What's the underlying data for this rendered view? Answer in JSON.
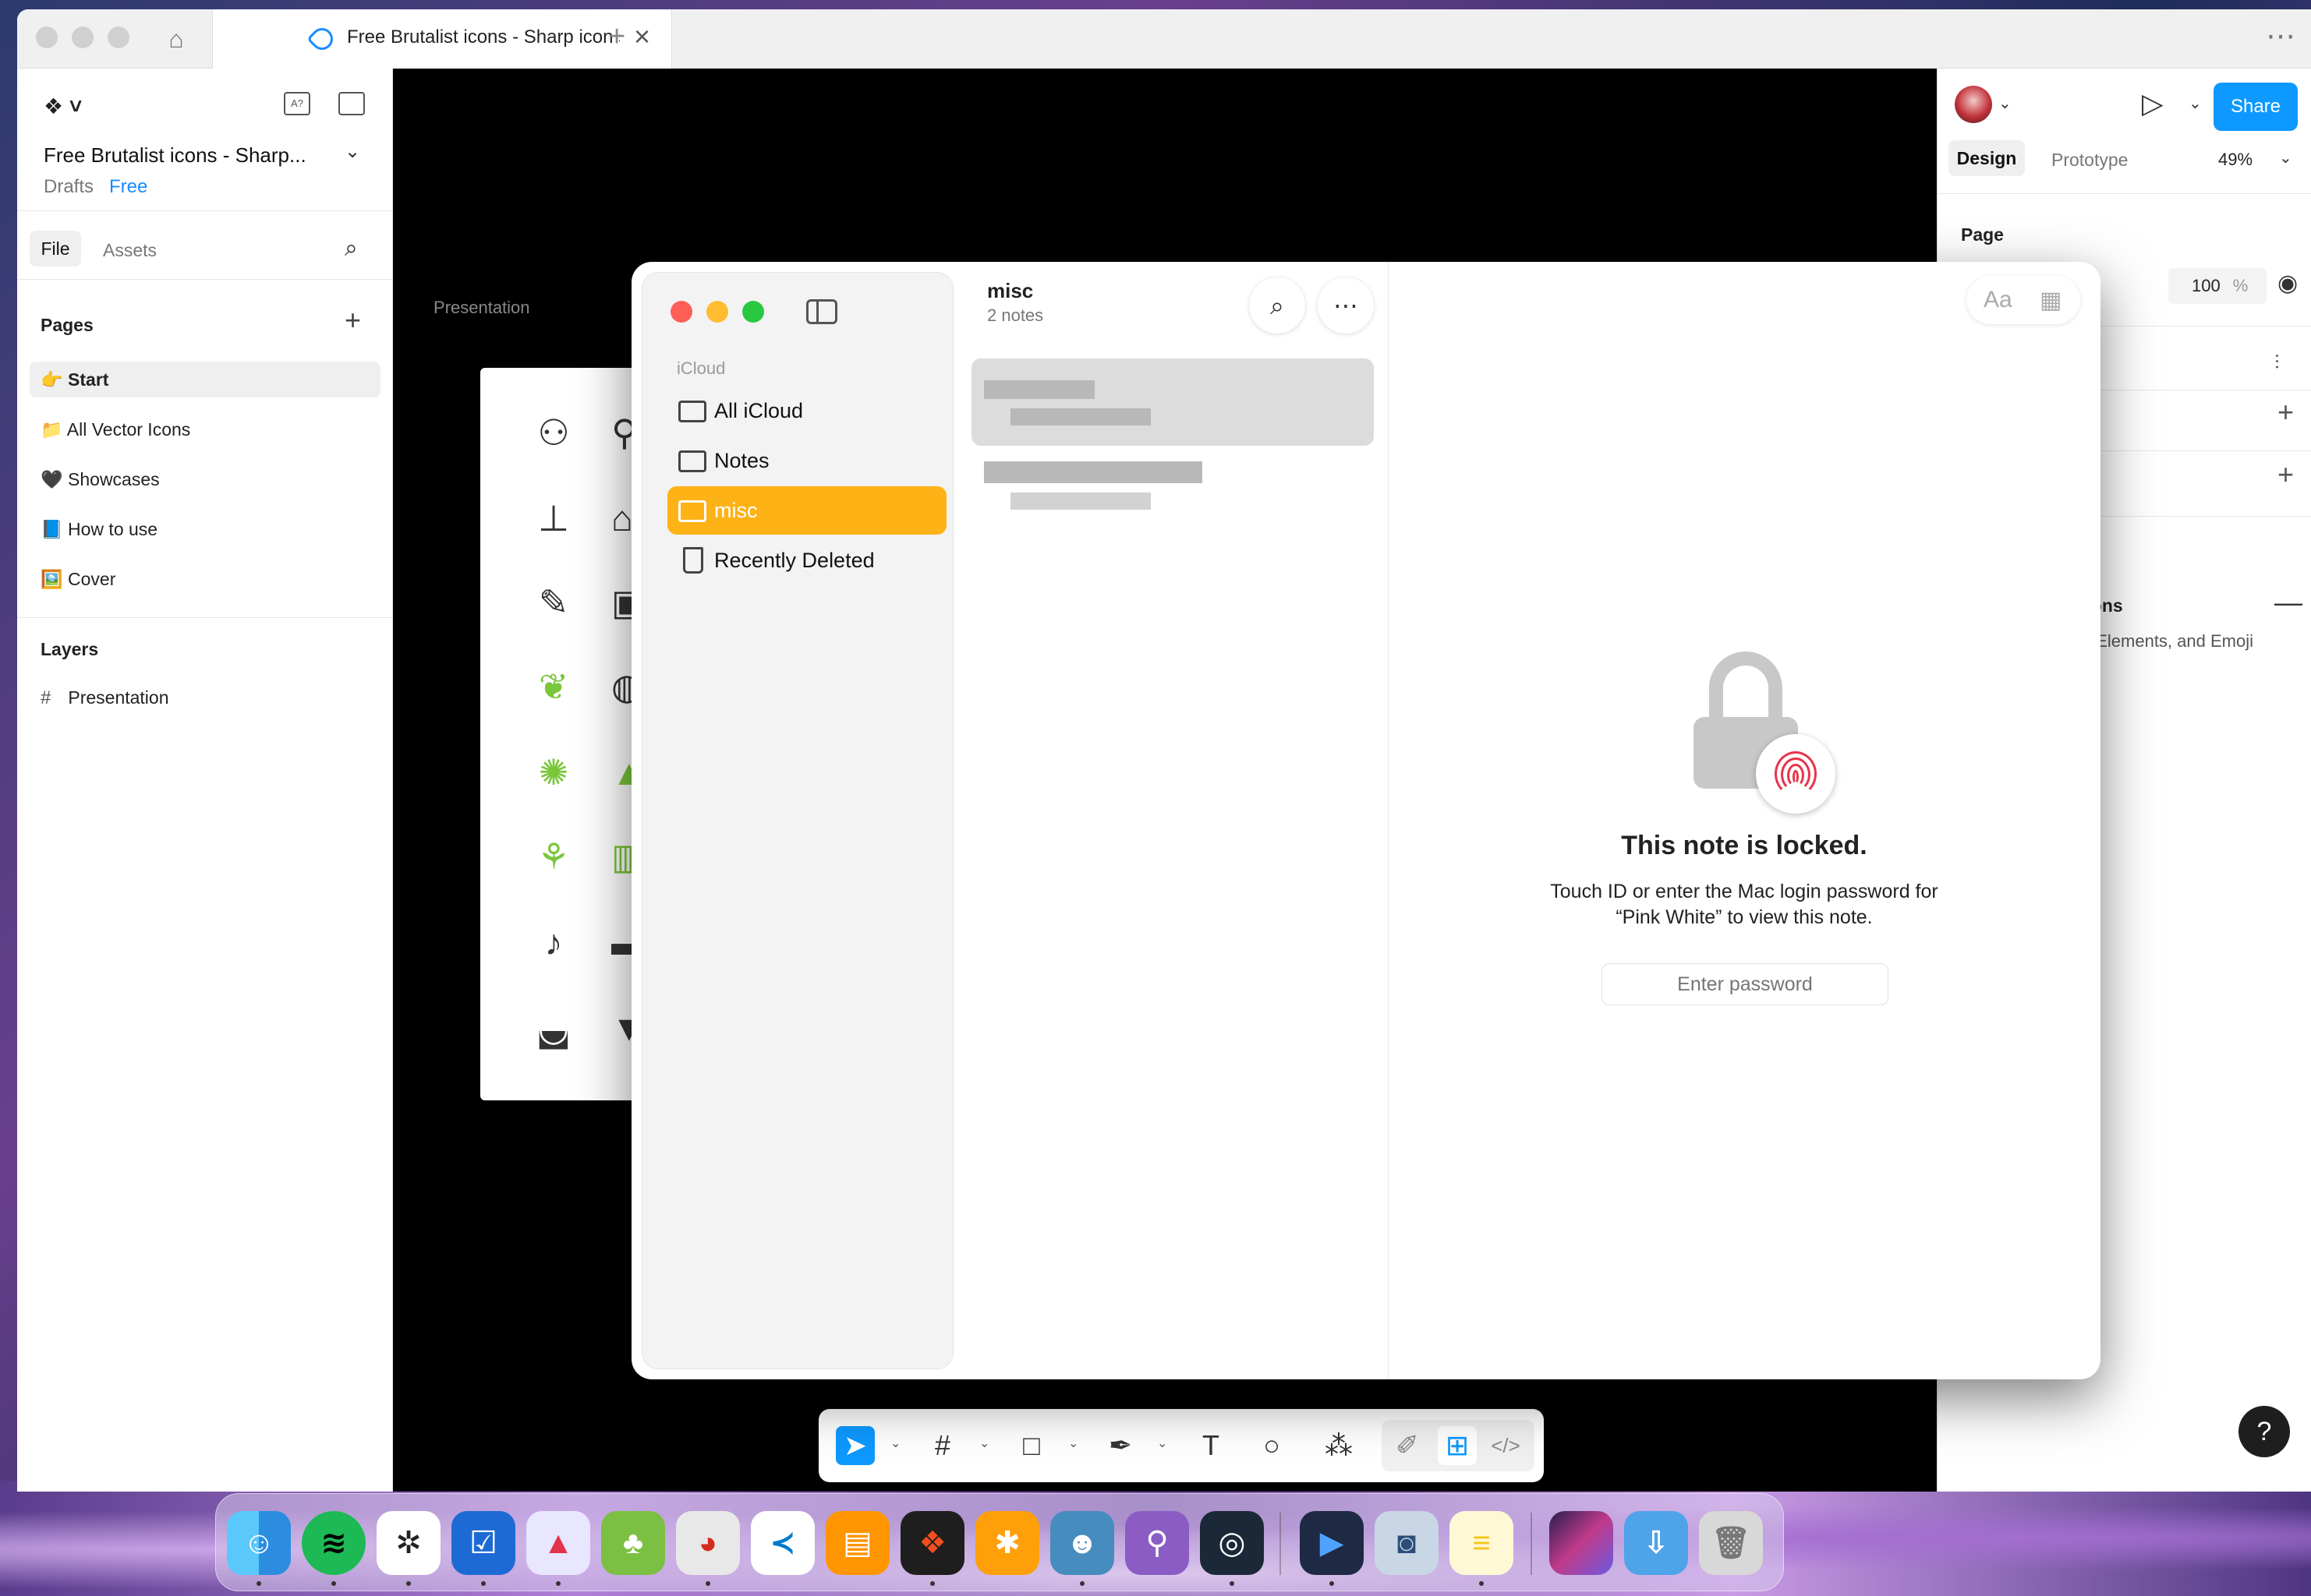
{
  "figma": {
    "tab_title": "Free Brutalist icons - Sharp icon s",
    "file_title": "Free Brutalist icons - Sharp...",
    "drafts": "Drafts",
    "plan": "Free",
    "file_tab": "File",
    "assets_tab": "Assets",
    "pages_heading": "Pages",
    "pages": [
      "👉 Start",
      "📁 All Vector Icons",
      "🖤 Showcases",
      "📘 How to use",
      "🖼️ Cover"
    ],
    "layers_heading": "Layers",
    "layer": "Presentation",
    "canvas_label": "Presentation",
    "share": "Share",
    "design_tab": "Design",
    "prototype_tab": "Prototype",
    "zoom": "49%",
    "page_section": "Page",
    "opacity": "100",
    "opacity_unit": "%",
    "icons_section": "cons",
    "icons_sub": "s, Elements, and Emoji",
    "help": "?"
  },
  "notes": {
    "sidebar_group": "iCloud",
    "folders": [
      "All iCloud",
      "Notes",
      "misc",
      "Recently Deleted"
    ],
    "selected_folder": "misc",
    "list_title": "misc",
    "list_count": "2 notes",
    "format_icon": "Aa",
    "locked_title": "This note is locked.",
    "locked_line1": "Touch ID or enter the Mac login password for",
    "locked_line2": "“Pink White” to view this note.",
    "password_placeholder": "Enter password"
  },
  "icons": {
    "home": "home-icon",
    "search": "search-icon",
    "more": "ellipsis-icon",
    "lock": "lock-icon",
    "fingerprint": "fingerprint-icon",
    "folder": "folder-icon",
    "trash": "trash-icon"
  },
  "colors": {
    "accent": "#0d99ff",
    "notes_selected": "#fdb216",
    "fingerprint": "#e8334a"
  }
}
